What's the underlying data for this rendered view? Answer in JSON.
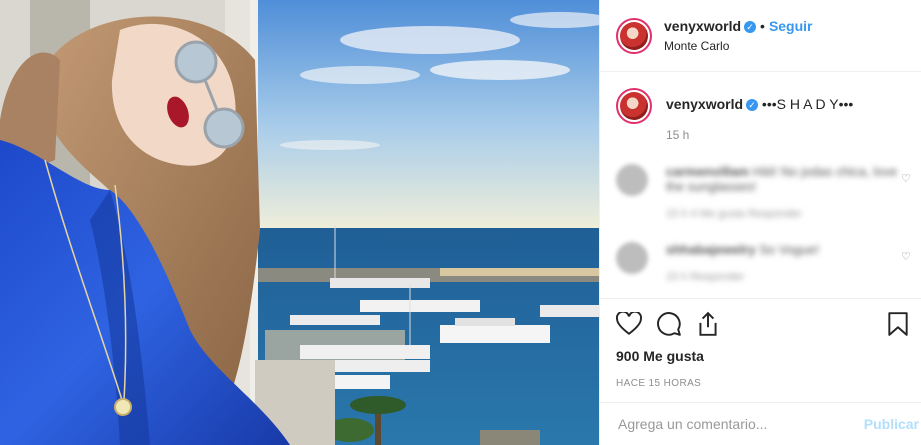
{
  "post": {
    "username": "venyxworld",
    "follow_label": "Seguir",
    "location": "Monte Carlo",
    "verified_mark": "✓"
  },
  "caption": {
    "username": "venyxworld",
    "text": "•••S H A D Y•••",
    "time": "15 h"
  },
  "comments": [
    {
      "user": "carmenvillam",
      "text": "Hiiii! No jodas chica, love the sunglasses!",
      "meta": "15 h   4 Me gusta   Responder"
    },
    {
      "user": "shhabajewelry",
      "text": "So Vogue!",
      "meta": "15 h   Responder"
    }
  ],
  "actions": {
    "likes": "900 Me gusta",
    "time_ago": "HACE 15 HORAS"
  },
  "add_comment": {
    "placeholder": "Agrega un comentario...",
    "publish_label": "Publicar"
  },
  "colors": {
    "accent": "#3897f0",
    "publish_disabled": "#b2dffc"
  }
}
